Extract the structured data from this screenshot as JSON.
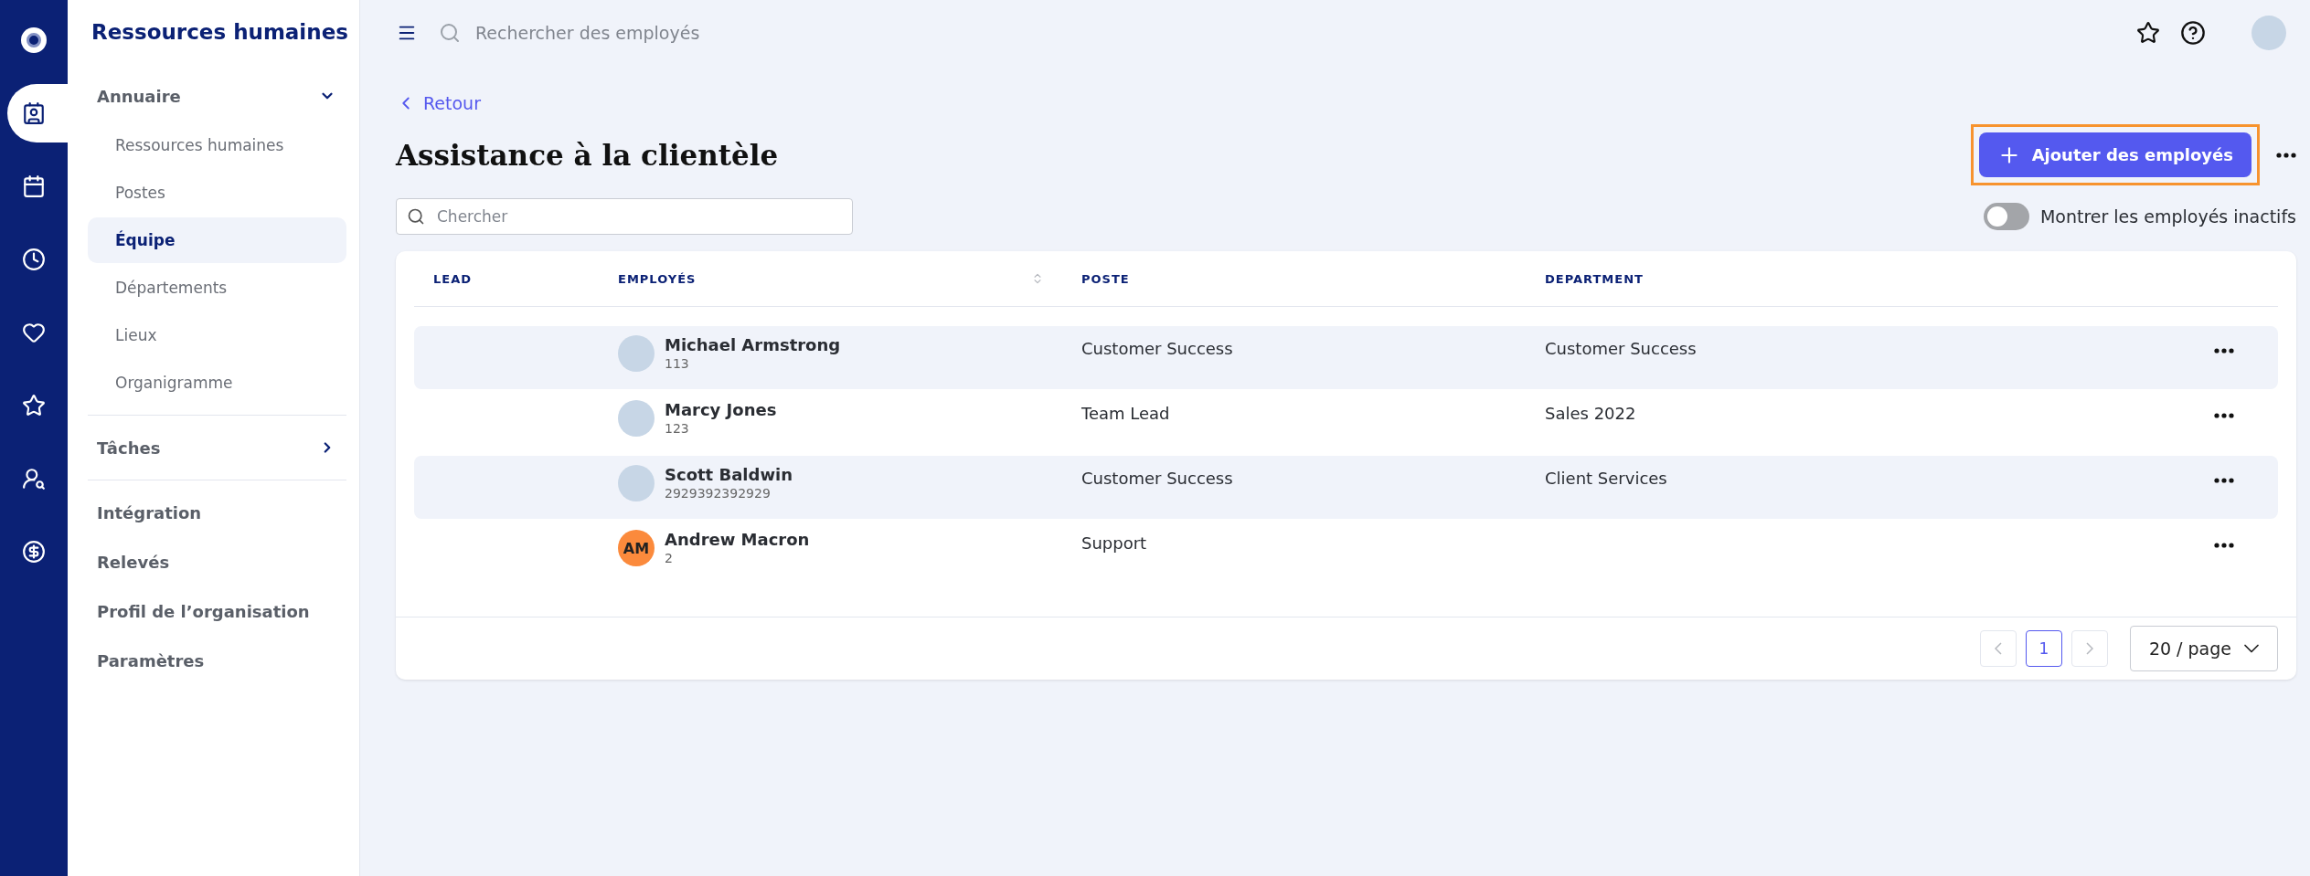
{
  "rail": [
    {
      "selected": false
    },
    {
      "selected": true
    },
    {
      "selected": false
    },
    {
      "selected": false
    },
    {
      "selected": false
    },
    {
      "selected": false
    },
    {
      "selected": false
    },
    {
      "selected": false
    }
  ],
  "sidebar": {
    "title": "Ressources humaines",
    "sections": [
      [
        {
          "label": "Annuaire",
          "expanded": true,
          "children": [
            {
              "label": "Ressources humaines",
              "selected": false
            },
            {
              "label": "Postes",
              "selected": false
            },
            {
              "label": "Équipe",
              "selected": true
            },
            {
              "label": "Départements",
              "selected": false
            },
            {
              "label": "Lieux",
              "selected": false
            },
            {
              "label": "Organigramme",
              "selected": false
            }
          ]
        }
      ],
      [
        {
          "label": "Tâches",
          "expanded": false
        }
      ],
      [
        {
          "label": "Intégration",
          "selected": false
        },
        {
          "label": "Relevés",
          "selected": false
        },
        {
          "label": "Profil de l’organisation",
          "selected": false
        },
        {
          "label": "Paramètres",
          "selected": false
        }
      ]
    ]
  },
  "topbar": {
    "search": {
      "placeholder": "Rechercher des employés"
    }
  },
  "page": {
    "back": "Retour",
    "title": "Assistance à la clientèle",
    "add_button": "Ajouter des employés",
    "search": {
      "placeholder": "Chercher"
    },
    "inactive_toggle": {
      "label": "Montrer les employés inactifs",
      "on": false
    }
  },
  "table": {
    "columns": [
      "LEAD",
      "EMPLOYÉS",
      "POSTE",
      "DEPARTMENT"
    ],
    "rows": [
      {
        "avatar": {
          "kind": "photo"
        },
        "name": "Michael Armstrong",
        "id": "113",
        "poste": "Customer Success",
        "department": "Customer Success"
      },
      {
        "avatar": {
          "kind": "photo"
        },
        "name": "Marcy Jones",
        "id": "123",
        "poste": "Team Lead",
        "department": "Sales 2022"
      },
      {
        "avatar": {
          "kind": "photo"
        },
        "name": "Scott Baldwin",
        "id": "2929392392929",
        "poste": "Customer Success",
        "department": "Client Services"
      },
      {
        "avatar": {
          "kind": "initials",
          "initials": "AM"
        },
        "name": "Andrew Macron",
        "id": "2",
        "poste": "Support"
      }
    ]
  },
  "pagination": {
    "prev_disabled": true,
    "next_disabled": true,
    "pages": [
      {
        "label": "1",
        "selected": true
      }
    ],
    "page_size": "20 / page"
  }
}
